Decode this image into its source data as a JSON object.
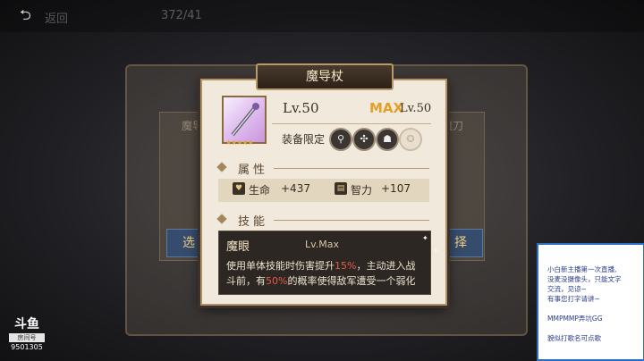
{
  "top": {
    "ghost_left": "返回",
    "ghost_right": "372/41"
  },
  "side": {
    "left_label": "魔导",
    "left_btn": "选",
    "right_label": "魔刀",
    "right_btn": "择"
  },
  "dialog": {
    "title": "魔导杖",
    "level": "Lv.50",
    "max_badge": "MAX",
    "max_level": "Lv.50",
    "equip_label": "装备限定",
    "stars": "★★★★★",
    "class_icons": [
      "mage-icon",
      "priest-icon",
      "cat-icon",
      "locked-icon"
    ],
    "attributes_header": "属性",
    "stats": [
      {
        "name": "生命",
        "value": "+437",
        "icon": "heart-icon"
      },
      {
        "name": "智力",
        "value": "+107",
        "icon": "book-icon"
      }
    ],
    "skills_header": "技能",
    "skill": {
      "name": "魔眼",
      "level": "Lv.Max",
      "desc_1": "使用单体技能时伤害提升",
      "desc_highlight_1": "15%",
      "desc_2": "，主动进入战斗前，有",
      "desc_highlight_2": "50%",
      "desc_3": "的概率使得敌军遭受一个弱化"
    }
  },
  "chat": {
    "lines": [
      "小白新主播第一次直播,",
      "没麦没摄像头，只能文字",
      "交流，见谅~",
      "有事您打字请讲~",
      "",
      "MMPMMP弄坑GG",
      "",
      "貌似打歌名可点歌"
    ]
  },
  "logo": {
    "brand": "斗鱼",
    "room_label": "房间号",
    "room_number": "9501305"
  },
  "colors": {
    "max": "#e2a02b",
    "highlight": "#e65a4a",
    "chat_border": "#2b6fc4"
  }
}
